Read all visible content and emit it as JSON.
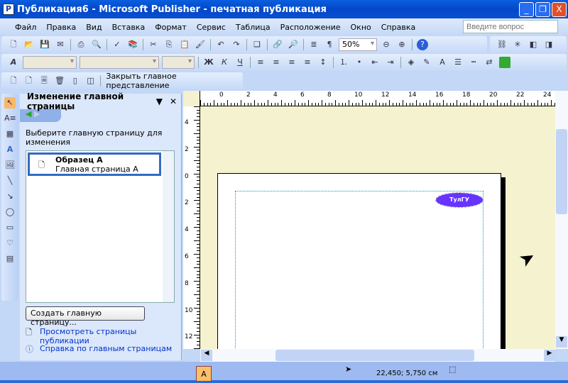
{
  "window": {
    "title": "Публикация6 - Microsoft Publisher - печатная публикация",
    "app_icon": "P",
    "minimize": "_",
    "maximize": "❐",
    "close": "X"
  },
  "menu": [
    "Файл",
    "Правка",
    "Вид",
    "Вставка",
    "Формат",
    "Сервис",
    "Таблица",
    "Расположение",
    "Окно",
    "Справка"
  ],
  "ask_placeholder": "Введите вопрос",
  "zoom": "50%",
  "format_bar": {
    "bold": "Ж",
    "italic": "К",
    "underline": "Ч"
  },
  "master_toolbar": {
    "close_label": "Закрыть главное представление"
  },
  "task_pane": {
    "title": "Изменение главной страницы",
    "instruction": "Выберите главную страницу для изменения",
    "items": [
      {
        "name": "Образец А",
        "desc": "Главная страница А"
      }
    ],
    "create_button": "Создать главную страницу...",
    "links": [
      "Просмотреть страницы публикации",
      "Справка по главным страницам"
    ]
  },
  "document": {
    "logo_text": "ТулГУ"
  },
  "rulers": {
    "h": [
      "0",
      "2",
      "4",
      "6",
      "8",
      "10",
      "12",
      "14",
      "16",
      "18",
      "20",
      "22",
      "24"
    ],
    "v": [
      "4",
      "2",
      "0",
      "2",
      "4",
      "6",
      "8",
      "10",
      "12"
    ]
  },
  "status": {
    "page": "A",
    "position": "22,450; 5,750 см"
  }
}
